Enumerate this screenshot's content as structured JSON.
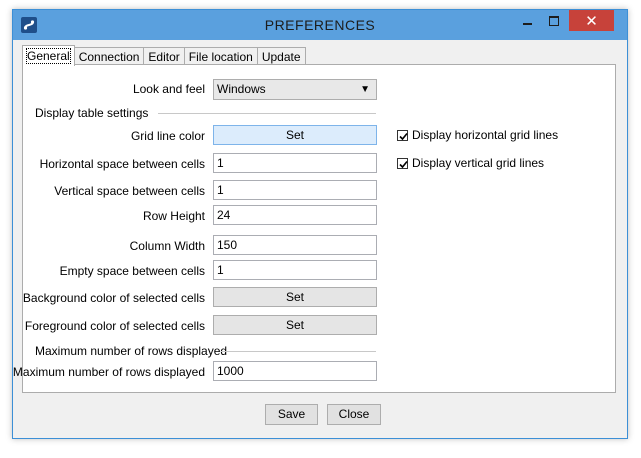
{
  "window": {
    "title": "PREFERENCES"
  },
  "tabs": [
    {
      "label": "General"
    },
    {
      "label": "Connection"
    },
    {
      "label": "Editor"
    },
    {
      "label": "File location"
    },
    {
      "label": "Update"
    }
  ],
  "general": {
    "look_and_feel": {
      "label": "Look and feel",
      "value": "Windows"
    },
    "display_table_settings": "Display table settings",
    "grid_line_color": {
      "label": "Grid line color",
      "button": "Set"
    },
    "horizontal_space": {
      "label": "Horizontal space between cells",
      "value": "1"
    },
    "vertical_space": {
      "label": "Vertical space between cells",
      "value": "1"
    },
    "row_height": {
      "label": "Row Height",
      "value": "24"
    },
    "column_width": {
      "label": "Column Width",
      "value": "150"
    },
    "empty_space": {
      "label": "Empty space between cells",
      "value": "1"
    },
    "bg_selected": {
      "label": "Background color of selected cells",
      "button": "Set"
    },
    "fg_selected": {
      "label": "Foreground color of selected cells",
      "button": "Set"
    },
    "max_rows_section": "Maximum number of rows displayed",
    "max_rows": {
      "label": "Maximum number of rows displayed",
      "value": "1000"
    },
    "horizontal_grid": {
      "label": "Display horizontal grid lines",
      "checked": true
    },
    "vertical_grid": {
      "label": "Display vertical grid lines",
      "checked": true
    }
  },
  "footer": {
    "save": "Save",
    "close": "Close"
  },
  "colors": {
    "titlebar": "#5aa0de",
    "close_button": "#c7423a"
  }
}
